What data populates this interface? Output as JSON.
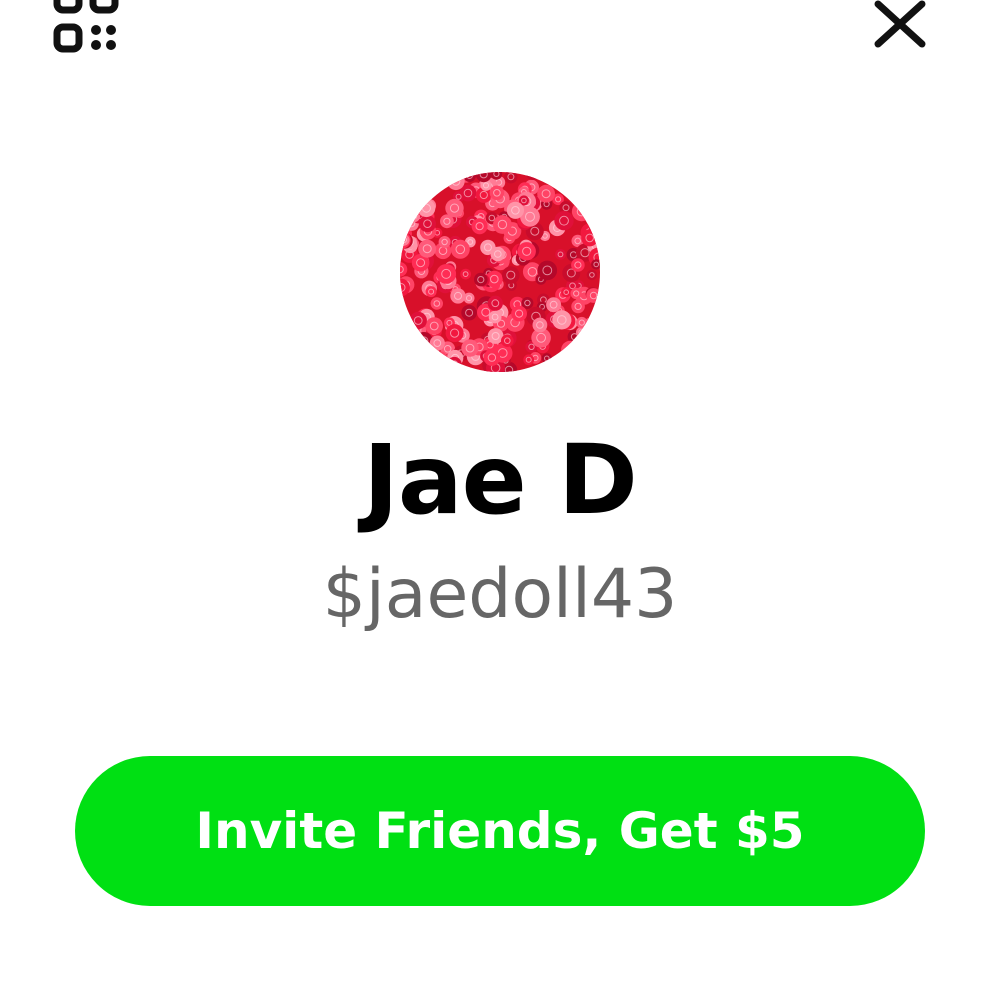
{
  "header": {
    "qr_icon": "qr-code-icon",
    "close_icon": "close-icon"
  },
  "profile": {
    "avatar": "roses-photo",
    "name": "Jae D",
    "cashtag": "$jaedoll43"
  },
  "invite": {
    "label": "Invite Friends, Get $5",
    "color": "#00E013"
  },
  "colors": {
    "background": "#FFFFFF",
    "name_text": "#000000",
    "cashtag_text": "#666666",
    "button_text": "#FFFFFF"
  }
}
